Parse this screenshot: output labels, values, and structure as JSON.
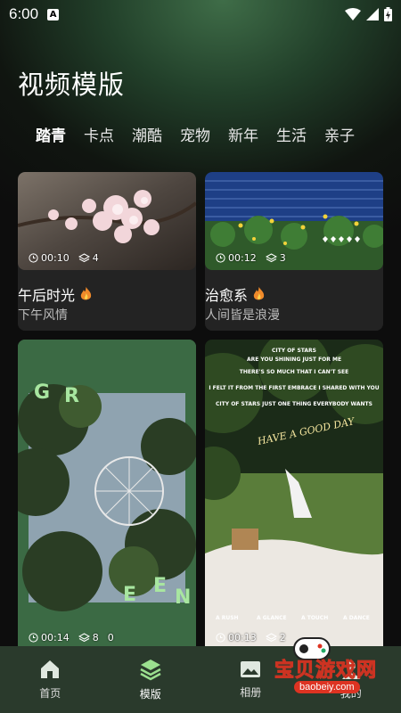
{
  "status": {
    "time": "6:00",
    "notif_glyph": "A"
  },
  "page": {
    "title": "视频模版"
  },
  "tabs": [
    {
      "label": "踏青",
      "active": true
    },
    {
      "label": "卡点"
    },
    {
      "label": "潮酷"
    },
    {
      "label": "宠物"
    },
    {
      "label": "新年"
    },
    {
      "label": "生活"
    },
    {
      "label": "亲子"
    }
  ],
  "cards": [
    {
      "title": "午后时光",
      "subtitle": "下午风情",
      "duration": "00:10",
      "layers": "4"
    },
    {
      "title": "治愈系",
      "subtitle": "人间皆是浪漫",
      "duration": "00:12",
      "layers": "3"
    },
    {
      "duration": "00:14",
      "layers": "8",
      "extra": "0",
      "poster_text": [
        "G",
        "R",
        "E",
        "E",
        "N"
      ]
    },
    {
      "duration": "00:13",
      "layers": "2",
      "poster_lines": [
        "CITY OF STARS",
        "ARE YOU SHINING JUST FOR ME",
        "THERE'S SO MUCH THAT I CAN'T SEE",
        "I FELT IT FROM THE FIRST EMBRACE I SHARED WITH YOU",
        "CITY OF STARS JUST ONE THING EVERYBODY WANTS"
      ],
      "handwriting": "HAVE A GOOD DAY",
      "captions": [
        "A RUSH",
        "A GLANCE",
        "A TOUCH",
        "A DANCE"
      ]
    }
  ],
  "nav": [
    {
      "label": "首页",
      "icon": "home-icon"
    },
    {
      "label": "模版",
      "icon": "layers-icon"
    },
    {
      "label": "相册",
      "icon": "album-icon"
    },
    {
      "label": "我的",
      "icon": "profile-icon"
    }
  ],
  "watermark": {
    "text": "宝贝游戏网",
    "url": "baobeiy.com"
  },
  "colors": {
    "accent": "#3b6a44",
    "nav_bg": "#2a3a2c",
    "watermark_yellow": "#ffdf3a"
  }
}
